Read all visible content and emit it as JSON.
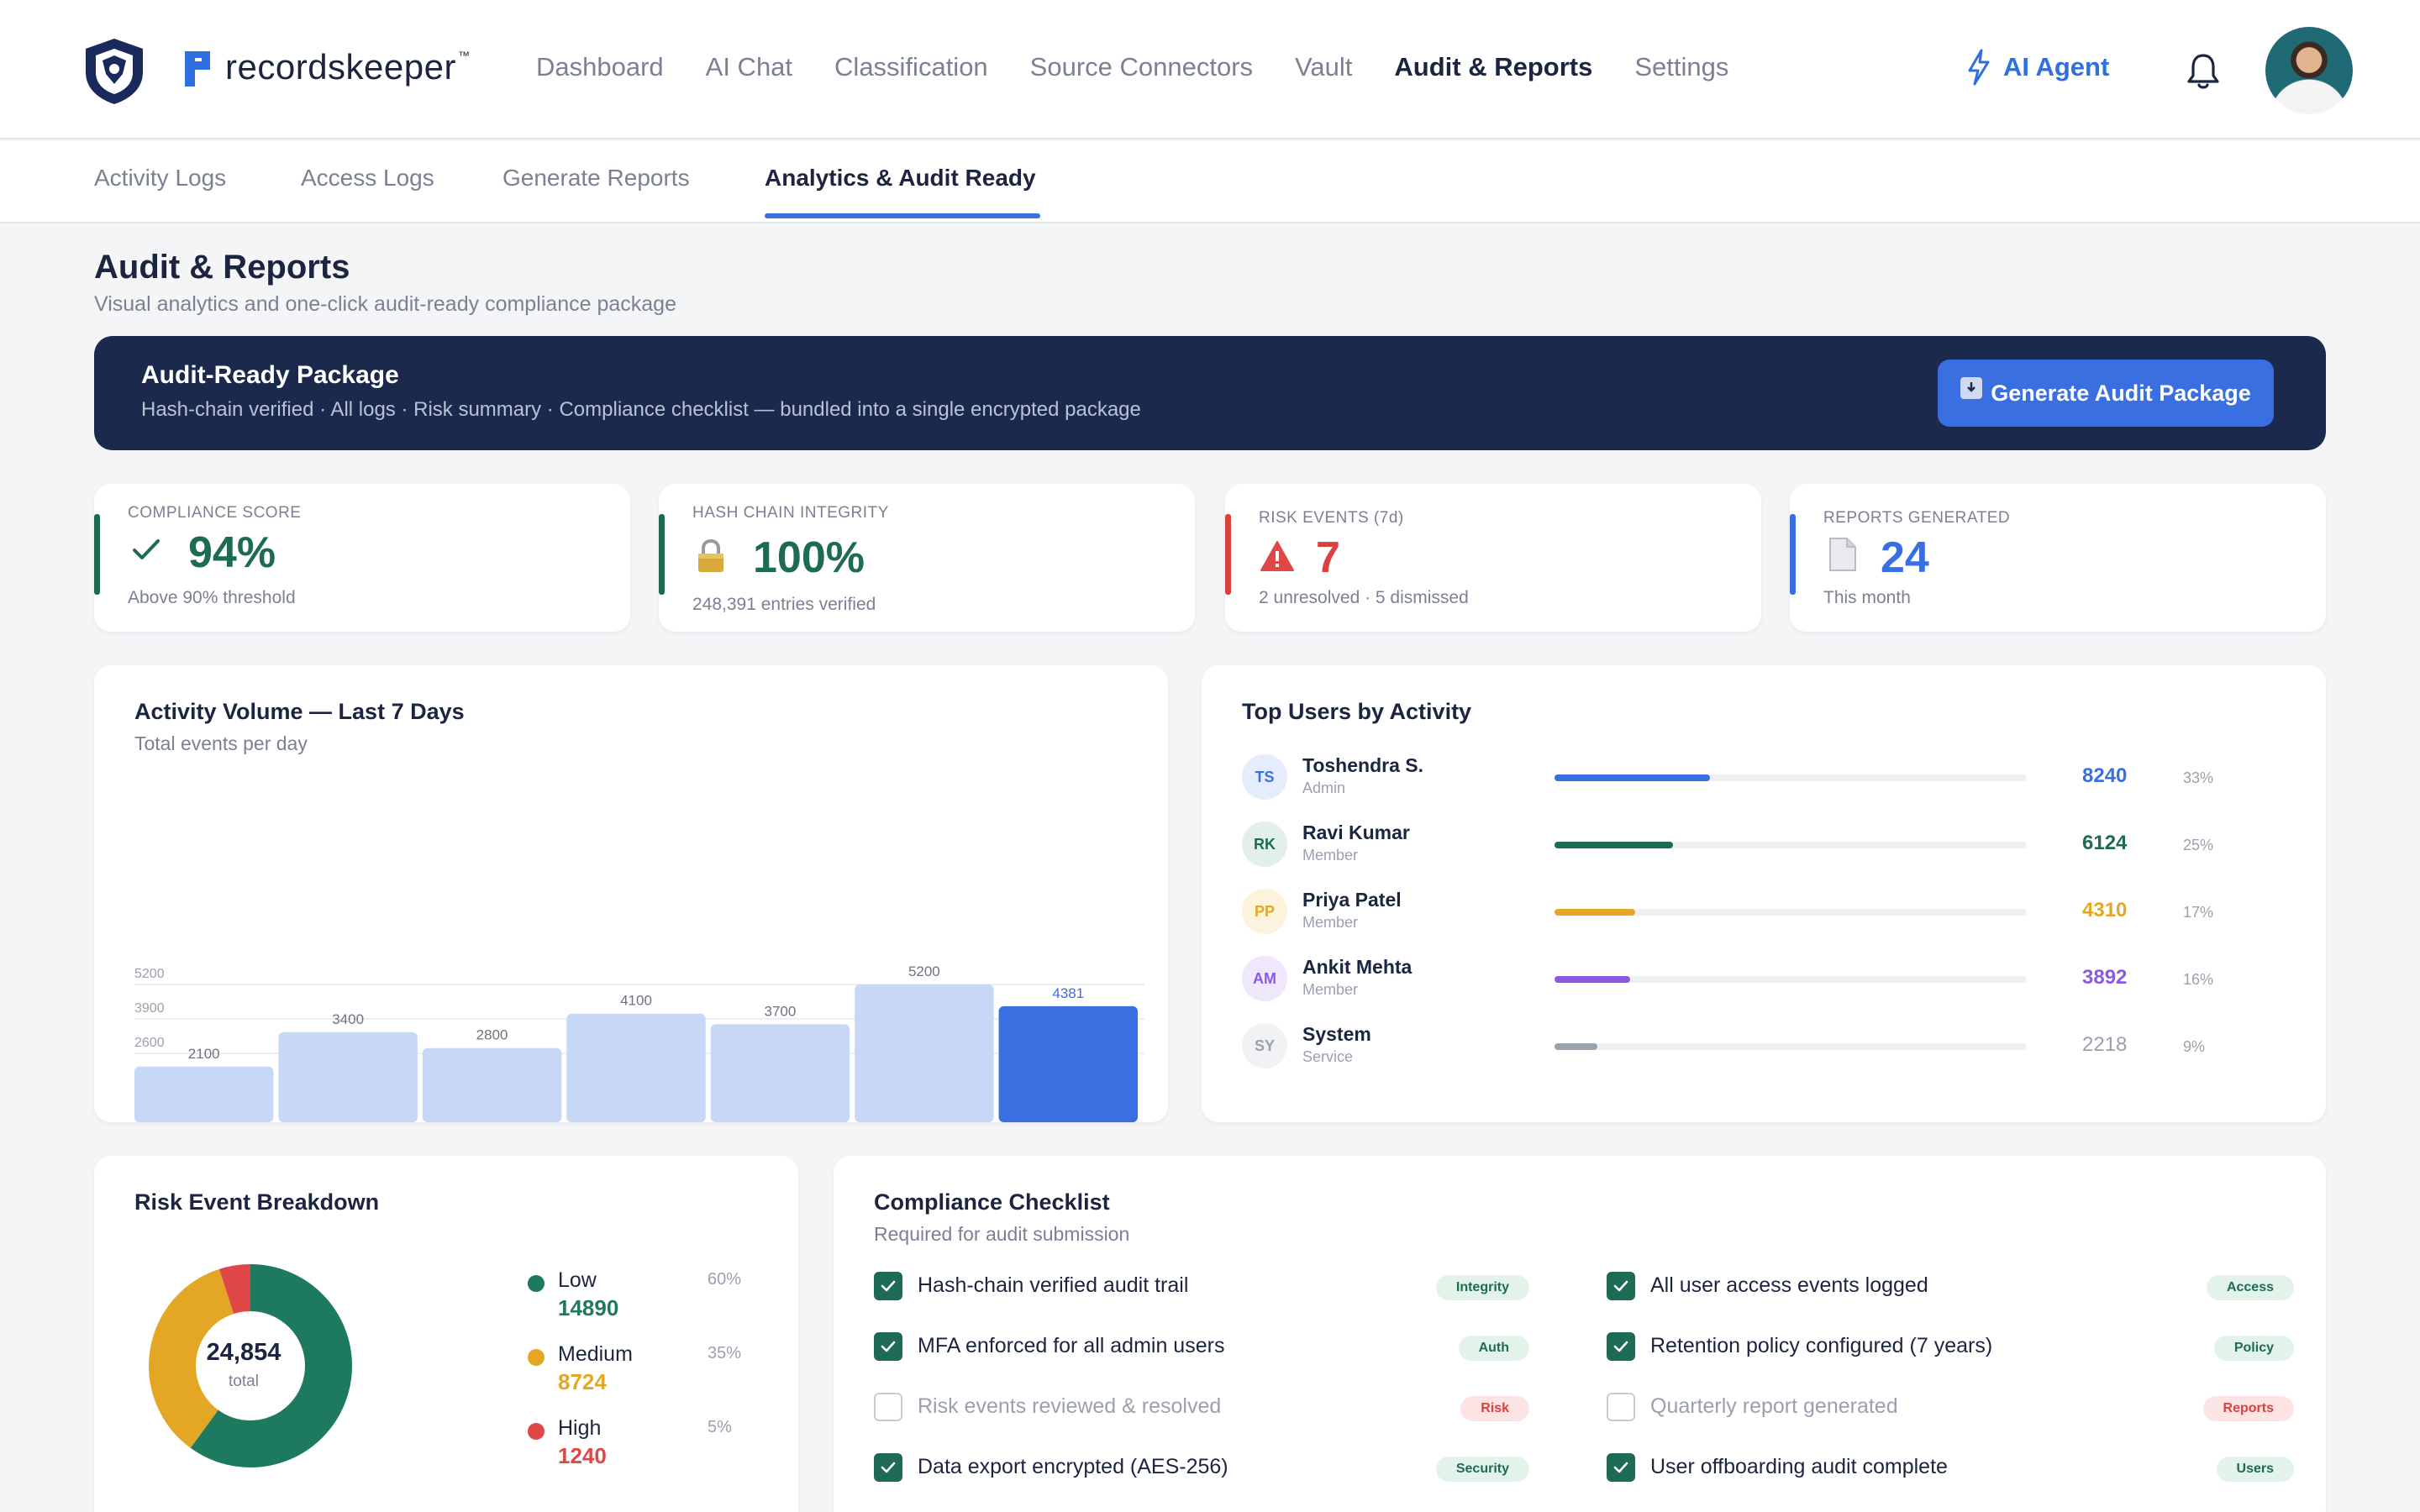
{
  "app": {
    "brand": "recordskeeper",
    "brand_tm": "™"
  },
  "nav": {
    "items": [
      {
        "label": "Dashboard"
      },
      {
        "label": "AI Chat"
      },
      {
        "label": "Classification"
      },
      {
        "label": "Source Connectors"
      },
      {
        "label": "Vault"
      },
      {
        "label": "Audit & Reports"
      },
      {
        "label": "Settings"
      }
    ],
    "active": "Audit & Reports",
    "ai_agent": "AI Agent"
  },
  "subnav": {
    "tabs": [
      {
        "label": "Activity Logs"
      },
      {
        "label": "Access Logs"
      },
      {
        "label": "Generate Reports"
      },
      {
        "label": "Analytics & Audit Ready"
      }
    ],
    "active": "Analytics & Audit Ready"
  },
  "page": {
    "title": "Audit & Reports",
    "subtitle": "Visual analytics and one-click audit-ready compliance package"
  },
  "banner": {
    "title": "Audit-Ready Package",
    "subtitle": "Hash-chain verified · All logs · Risk summary · Compliance checklist  — bundled into a single encrypted package",
    "button": "Generate Audit Package"
  },
  "stats": [
    {
      "label": "COMPLIANCE SCORE",
      "value": "94%",
      "foot": "Above 90% threshold",
      "icon": "check-icon",
      "color": "#1e6b55"
    },
    {
      "label": "HASH CHAIN INTEGRITY",
      "value": "100%",
      "foot": "248,391 entries verified",
      "icon": "lock-icon",
      "color": "#1e6b55"
    },
    {
      "label": "RISK EVENTS (7d)",
      "value": "7",
      "foot": "2 unresolved · 5 dismissed",
      "icon": "warning-icon",
      "color": "#d9413f"
    },
    {
      "label": "REPORTS GENERATED",
      "value": "24",
      "foot": "This month",
      "icon": "document-icon",
      "color": "#3a6fe2"
    }
  ],
  "activity": {
    "title": "Activity Volume — Last 7 Days",
    "subtitle": "Total events per day"
  },
  "chart_data": {
    "type": "bar",
    "title": "Activity Volume — Last 7 Days",
    "subtitle": "Total events per day",
    "categories": [],
    "values": [
      2100,
      3400,
      2800,
      4100,
      3700,
      5200,
      4381
    ],
    "y_ticks": [
      2600,
      3900,
      5200
    ],
    "highlight_index": 6,
    "colors": {
      "bar": "#c7d8f6",
      "highlight": "#3a6fe2"
    },
    "grid": true
  },
  "top_users": {
    "title": "Top Users by Activity",
    "users": [
      {
        "initials": "TS",
        "name": "Toshendra S.",
        "role": "Admin",
        "count": "8240",
        "pct": "33%",
        "fraction": 0.33,
        "color": "#3a6fe2",
        "bg": "#e5edfc"
      },
      {
        "initials": "RK",
        "name": "Ravi Kumar",
        "role": "Member",
        "count": "6124",
        "pct": "25%",
        "fraction": 0.25,
        "color": "#1e6b55",
        "bg": "#e3f0ea"
      },
      {
        "initials": "PP",
        "name": "Priya Patel",
        "role": "Member",
        "count": "4310",
        "pct": "17%",
        "fraction": 0.17,
        "color": "#e3a725",
        "bg": "#fdf3dc"
      },
      {
        "initials": "AM",
        "name": "Ankit Mehta",
        "role": "Member",
        "count": "3892",
        "pct": "16%",
        "fraction": 0.16,
        "color": "#8a5ae0",
        "bg": "#efe7fc"
      },
      {
        "initials": "SY",
        "name": "System",
        "role": "Service",
        "count": "2218",
        "pct": "9%",
        "fraction": 0.09,
        "color": "#9aa0ae",
        "bg": "#f1f2f4"
      }
    ]
  },
  "risk": {
    "title": "Risk Event Breakdown",
    "total": "24,854",
    "total_label": "total",
    "segments": [
      {
        "name": "Low",
        "value": "14890",
        "pct": "60%",
        "fraction": 0.6,
        "color": "#1e7a5e"
      },
      {
        "name": "Medium",
        "value": "8724",
        "pct": "35%",
        "fraction": 0.35,
        "color": "#e3a725"
      },
      {
        "name": "High",
        "value": "1240",
        "pct": "5%",
        "fraction": 0.05,
        "color": "#e04848"
      }
    ]
  },
  "checklist": {
    "title": "Compliance Checklist",
    "subtitle": "Required for audit submission",
    "items": [
      {
        "text": "Hash-chain verified audit trail",
        "tag": "Integrity",
        "done": true
      },
      {
        "text": "All user access events logged",
        "tag": "Access",
        "done": true
      },
      {
        "text": "MFA enforced for all admin users",
        "tag": "Auth",
        "done": true
      },
      {
        "text": "Retention policy configured (7 years)",
        "tag": "Policy",
        "done": true
      },
      {
        "text": "Risk events reviewed & resolved",
        "tag": "Risk",
        "done": false
      },
      {
        "text": "Quarterly report generated",
        "tag": "Reports",
        "done": false
      },
      {
        "text": "Data export encrypted (AES-256)",
        "tag": "Security",
        "done": true
      },
      {
        "text": "User offboarding audit complete",
        "tag": "Users",
        "done": true
      }
    ]
  }
}
